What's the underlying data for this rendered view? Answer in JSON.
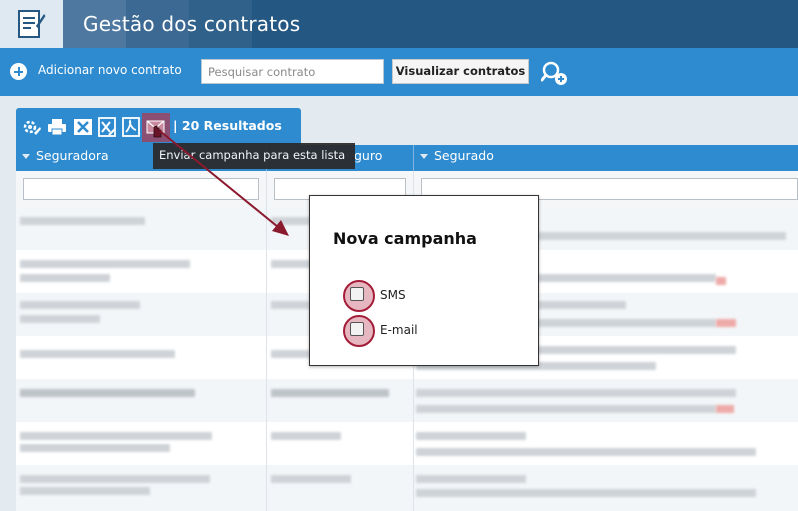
{
  "header": {
    "title": "Gestão dos contratos",
    "logo_icon": "contract-document-icon",
    "colors": {
      "bar": "#245883",
      "logo_bg": "#dfe9f2"
    }
  },
  "toolbar": {
    "add_label": "Adicionar novo contrato",
    "add_icon": "plus-circle-icon",
    "search_placeholder": "Pesquisar contrato",
    "search_value": "",
    "view_button_label": "Visualizar contratos",
    "advanced_search_icon": "user-search-add-icon",
    "color": "#2e8bd0"
  },
  "results_tab": {
    "icons": [
      "settings-tools-icon",
      "print-icon",
      "excel-export-icon",
      "excel-chart-export-icon",
      "pdf-export-icon",
      "send-campaign-icon"
    ],
    "results_label": "| 20 Resultados"
  },
  "table": {
    "columns": [
      "Seguradora",
      "",
      "Segurado"
    ],
    "visible_partial_column_text": "guro"
  },
  "tooltip": {
    "text": "Enviar campanha para esta lista"
  },
  "modal": {
    "title": "Nova campanha",
    "options": [
      {
        "label": "SMS",
        "checked": false
      },
      {
        "label": "E-mail",
        "checked": false
      }
    ],
    "accent_color": "#a31c38"
  }
}
